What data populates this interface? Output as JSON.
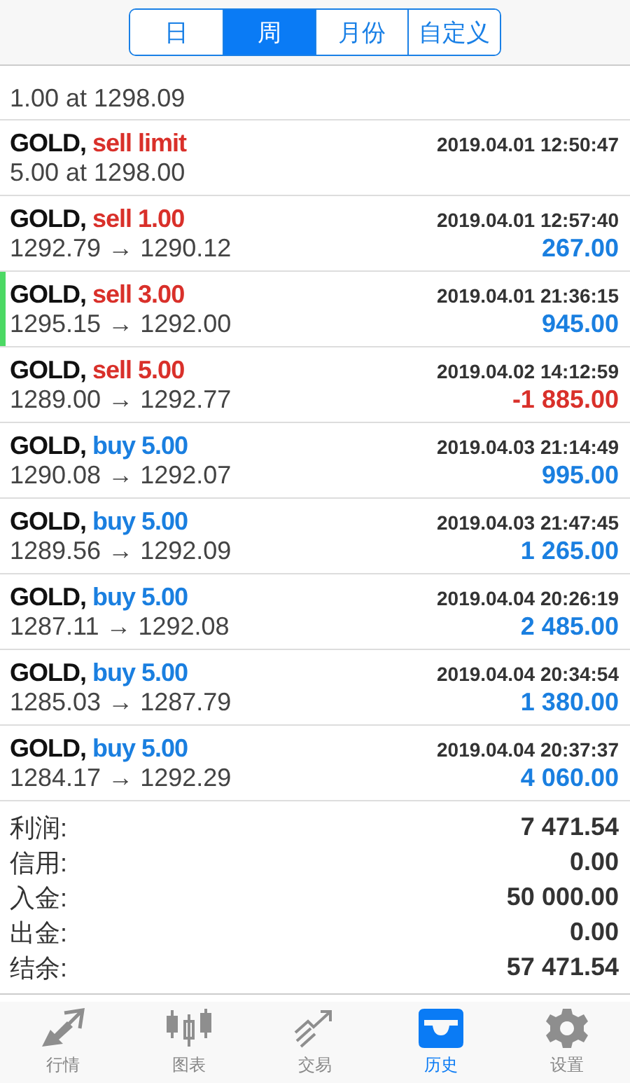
{
  "segments": [
    {
      "label": "日",
      "selected": false
    },
    {
      "label": "周",
      "selected": true
    },
    {
      "label": "月份",
      "selected": false
    },
    {
      "label": "自定义",
      "selected": false
    }
  ],
  "rows": [
    {
      "kind": "order",
      "detail": "1.00 at 1298.09",
      "marked": false
    },
    {
      "kind": "order",
      "symbol": "GOLD,",
      "color": "#d9302a",
      "action": "sell limit",
      "time": "2019.04.01 12:50:47",
      "detail": "5.00 at 1298.00",
      "marked": false
    },
    {
      "kind": "deal",
      "symbol": "GOLD,",
      "color": "#d9302a",
      "action": "sell 1.00",
      "time": "2019.04.01 12:57:40",
      "detail": "1292.79 → 1290.12",
      "profit": "267.00",
      "negative": false,
      "marked": false
    },
    {
      "kind": "deal",
      "symbol": "GOLD,",
      "color": "#d9302a",
      "action": "sell 3.00",
      "time": "2019.04.01 21:36:15",
      "detail": "1295.15 → 1292.00",
      "profit": "945.00",
      "negative": false,
      "marked": true
    },
    {
      "kind": "deal",
      "symbol": "GOLD,",
      "color": "#d9302a",
      "action": "sell 5.00",
      "time": "2019.04.02 14:12:59",
      "detail": "1289.00 → 1292.77",
      "profit": "-1 885.00",
      "negative": true,
      "marked": false
    },
    {
      "kind": "deal",
      "symbol": "GOLD,",
      "color": "#1a7fe0",
      "action": "buy 5.00",
      "time": "2019.04.03 21:14:49",
      "detail": "1290.08 → 1292.07",
      "profit": "995.00",
      "negative": false,
      "marked": false
    },
    {
      "kind": "deal",
      "symbol": "GOLD,",
      "color": "#1a7fe0",
      "action": "buy 5.00",
      "time": "2019.04.03 21:47:45",
      "detail": "1289.56 → 1292.09",
      "profit": "1 265.00",
      "negative": false,
      "marked": false
    },
    {
      "kind": "deal",
      "symbol": "GOLD,",
      "color": "#1a7fe0",
      "action": "buy 5.00",
      "time": "2019.04.04 20:26:19",
      "detail": "1287.11 → 1292.08",
      "profit": "2 485.00",
      "negative": false,
      "marked": false
    },
    {
      "kind": "deal",
      "symbol": "GOLD,",
      "color": "#1a7fe0",
      "action": "buy 5.00",
      "time": "2019.04.04 20:34:54",
      "detail": "1285.03 → 1287.79",
      "profit": "1 380.00",
      "negative": false,
      "marked": false
    },
    {
      "kind": "deal",
      "symbol": "GOLD,",
      "color": "#1a7fe0",
      "action": "buy 5.00",
      "time": "2019.04.04 20:37:37",
      "detail": "1284.17 → 1292.29",
      "profit": "4 060.00",
      "negative": false,
      "marked": false
    }
  ],
  "summary": [
    {
      "label": "利润:",
      "value": "7 471.54"
    },
    {
      "label": "信用:",
      "value": "0.00"
    },
    {
      "label": "入金:",
      "value": "50 000.00"
    },
    {
      "label": "出金:",
      "value": "0.00"
    },
    {
      "label": "结余:",
      "value": "57 471.54"
    }
  ],
  "tabs": [
    {
      "label": "行情",
      "selected": false
    },
    {
      "label": "图表",
      "selected": false
    },
    {
      "label": "交易",
      "selected": false
    },
    {
      "label": "历史",
      "selected": true
    },
    {
      "label": "设置",
      "selected": false
    }
  ]
}
